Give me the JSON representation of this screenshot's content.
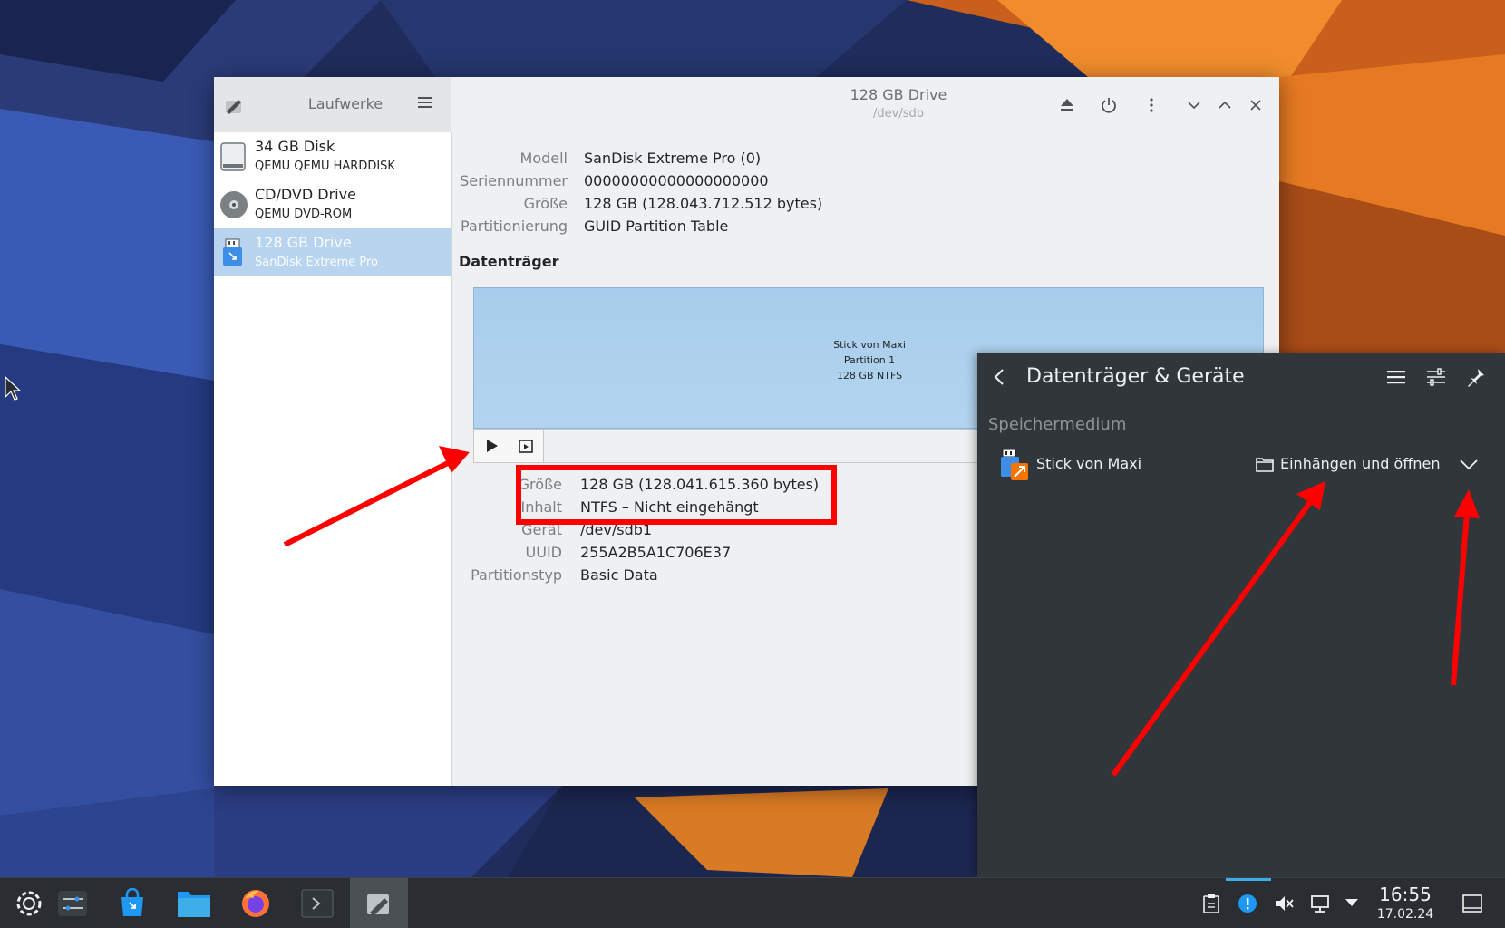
{
  "sidebar": {
    "title": "Laufwerke",
    "drives": [
      {
        "name": "34 GB Disk",
        "sub": "QEMU QEMU HARDDISK"
      },
      {
        "name": "CD/DVD Drive",
        "sub": "QEMU DVD-ROM"
      },
      {
        "name": "128 GB Drive",
        "sub": "SanDisk Extreme Pro"
      }
    ]
  },
  "header": {
    "title": "128 GB Drive",
    "subtitle": "/dev/sdb"
  },
  "drive_info": [
    {
      "label": "Modell",
      "value": "SanDisk Extreme Pro (0)"
    },
    {
      "label": "Seriennummer",
      "value": "00000000000000000000"
    },
    {
      "label": "Größe",
      "value": "128 GB (128.043.712.512 bytes)"
    },
    {
      "label": "Partitionierung",
      "value": "GUID Partition Table"
    }
  ],
  "volumes_title": "Datenträger",
  "partition": {
    "line1": "Stick von Maxi",
    "line2": "Partition 1",
    "line3": "128 GB NTFS"
  },
  "partition_info": [
    {
      "label": "Größe",
      "value": "128 GB (128.041.615.360 bytes)"
    },
    {
      "label": "Inhalt",
      "value": "NTFS – Nicht eingehängt"
    },
    {
      "label": "Gerät",
      "value": "/dev/sdb1"
    },
    {
      "label": "UUID",
      "value": "255A2B5A1C706E37"
    },
    {
      "label": "Partitionstyp",
      "value": "Basic Data"
    }
  ],
  "popup": {
    "title": "Datenträger & Geräte",
    "section": "Speichermedium",
    "device_name": "Stick von Maxi",
    "action_label": "Einhängen und öffnen"
  },
  "clock": {
    "time": "16:55",
    "date": "17.02.24"
  },
  "colors": {
    "selection": "#b9d4ee",
    "partition": "#a7cdec",
    "popup_bg": "#31363b",
    "annotation": "#ff0000",
    "taskbar": "#2a2e32"
  }
}
